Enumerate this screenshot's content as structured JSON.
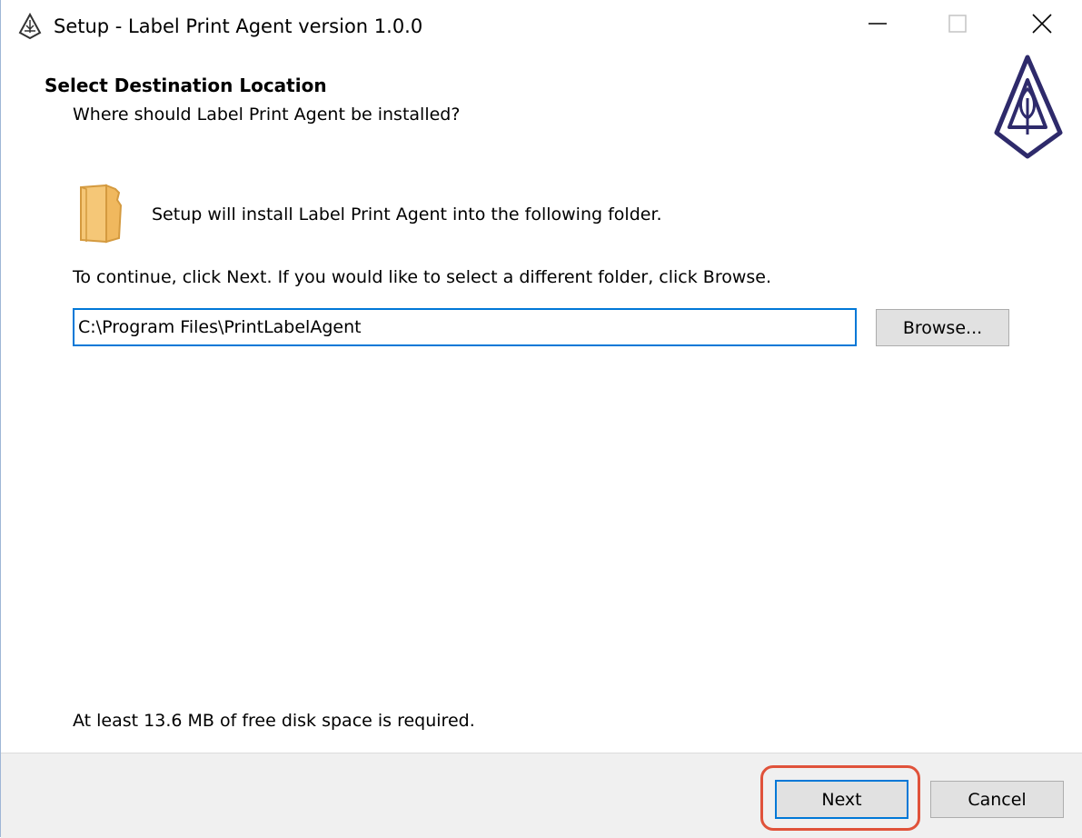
{
  "window": {
    "title": "Setup - Label Print Agent version 1.0.0",
    "app_icon": "tree-logo-icon",
    "controls": {
      "minimize_icon": "minimize-icon",
      "maximize_icon": "maximize-icon",
      "close_icon": "close-icon"
    }
  },
  "header": {
    "heading": "Select Destination Location",
    "subheading": "Where should Label Print Agent be installed?",
    "logo_icon": "tree-logo-icon",
    "logo_color": "#2e2a6b"
  },
  "body": {
    "folder_icon": "folder-icon",
    "install_text": "Setup will install Label Print Agent into the following folder.",
    "continue_text": "To continue, click Next. If you would like to select a different folder, click Browse.",
    "path_value": "C:\\Program Files\\PrintLabelAgent",
    "browse_label": "Browse...",
    "disk_space_text": "At least 13.6 MB of free disk space is required."
  },
  "footer": {
    "next_label": "Next",
    "cancel_label": "Cancel",
    "highlight_color": "#e0523a"
  },
  "colors": {
    "focus_blue": "#0078d7",
    "button_face": "#e1e1e1",
    "footer_bg": "#f0f0f0",
    "folder_fill": "#f5c777"
  }
}
